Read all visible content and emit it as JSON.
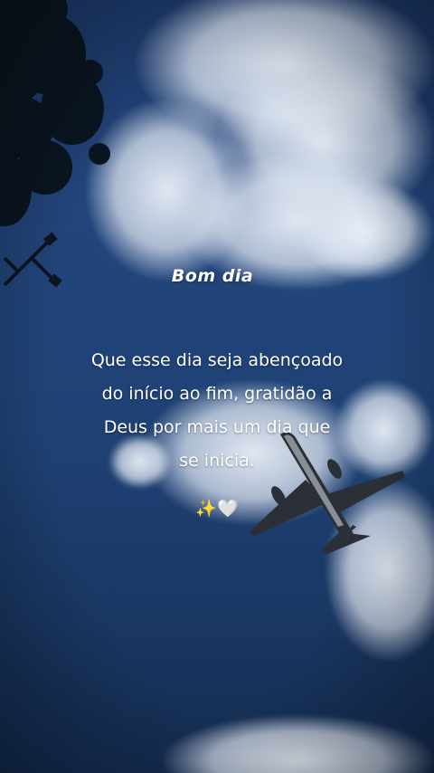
{
  "post": {
    "title": "Bom dia",
    "message_lines": [
      "Que esse dia seja abençoado",
      "do início ao fim, gratidão a",
      "Deus por mais um dia que",
      "se inicia."
    ],
    "emojis": "✨🤍"
  },
  "colors": {
    "sky_top": "#1d3a6b",
    "sky_bottom": "#152d52",
    "text": "#ffffff"
  },
  "icons": [
    "tree-silhouette",
    "street-lamp",
    "airplane-icon"
  ]
}
